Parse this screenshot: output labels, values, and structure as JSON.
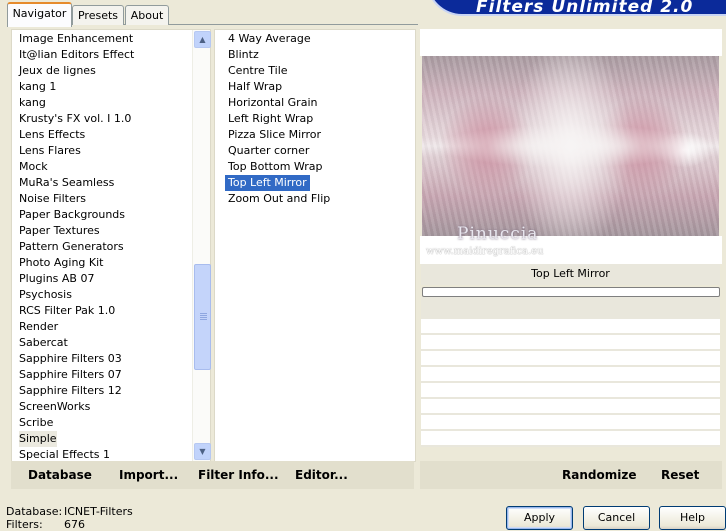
{
  "window": {
    "title": "Filters Unlimited 2.0"
  },
  "tabs": [
    {
      "label": "Navigator",
      "active": true
    },
    {
      "label": "Presets",
      "active": false
    },
    {
      "label": "About",
      "active": false
    }
  ],
  "categories": {
    "selected": "Simple",
    "items": [
      "Image Enhancement",
      "It@lian Editors Effect",
      "Jeux de lignes",
      "kang 1",
      "kang",
      "Krusty's FX vol. I 1.0",
      "Lens Effects",
      "Lens Flares",
      "Mock",
      "MuRa's Seamless",
      "Noise Filters",
      "Paper Backgrounds",
      "Paper Textures",
      "Pattern Generators",
      "Photo Aging Kit",
      "Plugins AB 07",
      "Psychosis",
      "RCS Filter Pak 1.0",
      "Render",
      "Sabercat",
      "Sapphire Filters 03",
      "Sapphire Filters 07",
      "Sapphire Filters 12",
      "ScreenWorks",
      "Scribe",
      "Simple",
      "Special Effects 1"
    ]
  },
  "filters": {
    "selected": "Top Left Mirror",
    "items": [
      "4 Way Average",
      "Blintz",
      "Centre Tile",
      "Half Wrap",
      "Horizontal Grain",
      "Left Right Wrap",
      "Pizza Slice Mirror",
      "Quarter corner",
      "Top Bottom Wrap",
      "Top Left Mirror",
      "Zoom Out and Flip"
    ]
  },
  "left_buttons": {
    "database": "Database",
    "import": "Import...",
    "filter_info": "Filter Info...",
    "editor": "Editor..."
  },
  "right_buttons": {
    "randomize": "Randomize",
    "reset": "Reset"
  },
  "preview": {
    "watermark_name": "Pinuccia",
    "watermark_url": "www.maidiregrafica.eu",
    "filter_name": "Top Left Mirror"
  },
  "status": {
    "database_label": "Database:",
    "database_value": "ICNET-Filters",
    "filters_label": "Filters:",
    "filters_value": "676"
  },
  "dialog_buttons": {
    "apply": "Apply",
    "cancel": "Cancel",
    "help": "Help"
  }
}
